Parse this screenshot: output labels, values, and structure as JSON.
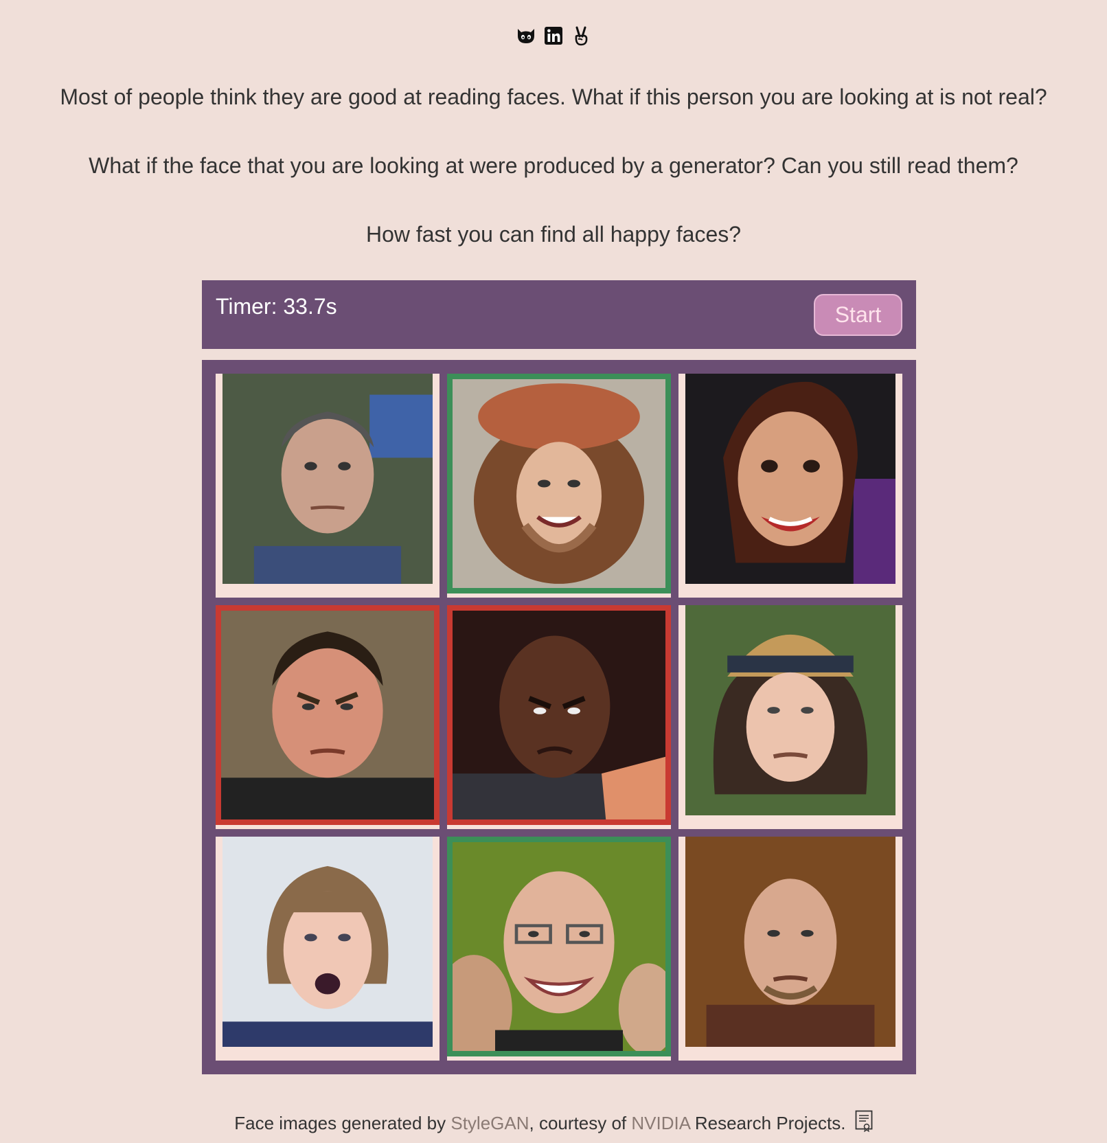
{
  "social": {
    "icons": [
      "github-icon",
      "linkedin-icon",
      "angellist-icon"
    ]
  },
  "intro": {
    "line1": "Most of people think they are good at reading faces. What if this person you are looking at is not real?",
    "line2": "What if the face that you are looking at were produced by a generator? Can you still read them?",
    "line3": "How fast you can find all happy faces?"
  },
  "game": {
    "timer_text": "Timer: 33.7s",
    "start_label": "Start",
    "colors": {
      "panel": "#6b4e74",
      "correct_border": "#3c8f58",
      "wrong_border": "#c93a32",
      "start_button": "#c98bb6"
    },
    "cells": [
      {
        "state": "none",
        "icon": "face-image"
      },
      {
        "state": "correct",
        "icon": "face-image"
      },
      {
        "state": "none",
        "icon": "face-image"
      },
      {
        "state": "wrong",
        "icon": "face-image"
      },
      {
        "state": "wrong",
        "icon": "face-image"
      },
      {
        "state": "none",
        "icon": "face-image"
      },
      {
        "state": "none",
        "icon": "face-image"
      },
      {
        "state": "correct",
        "icon": "face-image"
      },
      {
        "state": "none",
        "icon": "face-image"
      }
    ]
  },
  "footer": {
    "prefix": "Face images generated by ",
    "link1": "StyleGAN",
    "middle": ", courtesy of ",
    "link2": "NVIDIA",
    "suffix": " Research Projects.",
    "icon": "certificate-icon"
  }
}
